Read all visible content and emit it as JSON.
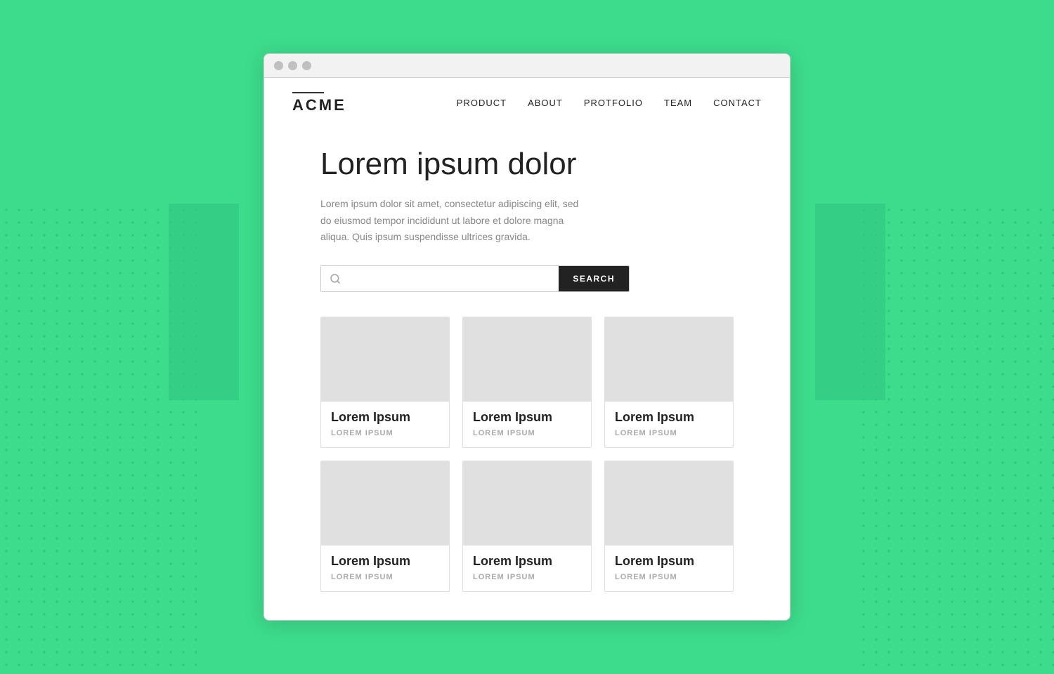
{
  "nav": {
    "logo": "ACME",
    "links": [
      "PRODUCT",
      "ABOUT",
      "PROTFOLIO",
      "TEAM",
      "CONTACT"
    ]
  },
  "hero": {
    "title": "Lorem ipsum dolor",
    "description": "Lorem ipsum dolor sit amet, consectetur adipiscing elit, sed do eiusmod tempor incididunt ut labore et dolore magna aliqua. Quis ipsum suspendisse ultrices gravida."
  },
  "search": {
    "placeholder": "",
    "button_label": "SEARCH"
  },
  "cards": [
    {
      "title": "Lorem Ipsum",
      "subtitle": "LOREM IPSUM"
    },
    {
      "title": "Lorem Ipsum",
      "subtitle": "LOREM IPSUM"
    },
    {
      "title": "Lorem Ipsum",
      "subtitle": "LOREM IPSUM"
    },
    {
      "title": "Lorem Ipsum",
      "subtitle": "LOREM IPSUM"
    },
    {
      "title": "Lorem Ipsum",
      "subtitle": "LOREM IPSUM"
    },
    {
      "title": "Lorem Ipsum",
      "subtitle": "LOREM IPSUM"
    }
  ],
  "colors": {
    "background": "#3ddc8c",
    "search_button": "#222222",
    "card_image": "#e0e0e0"
  }
}
